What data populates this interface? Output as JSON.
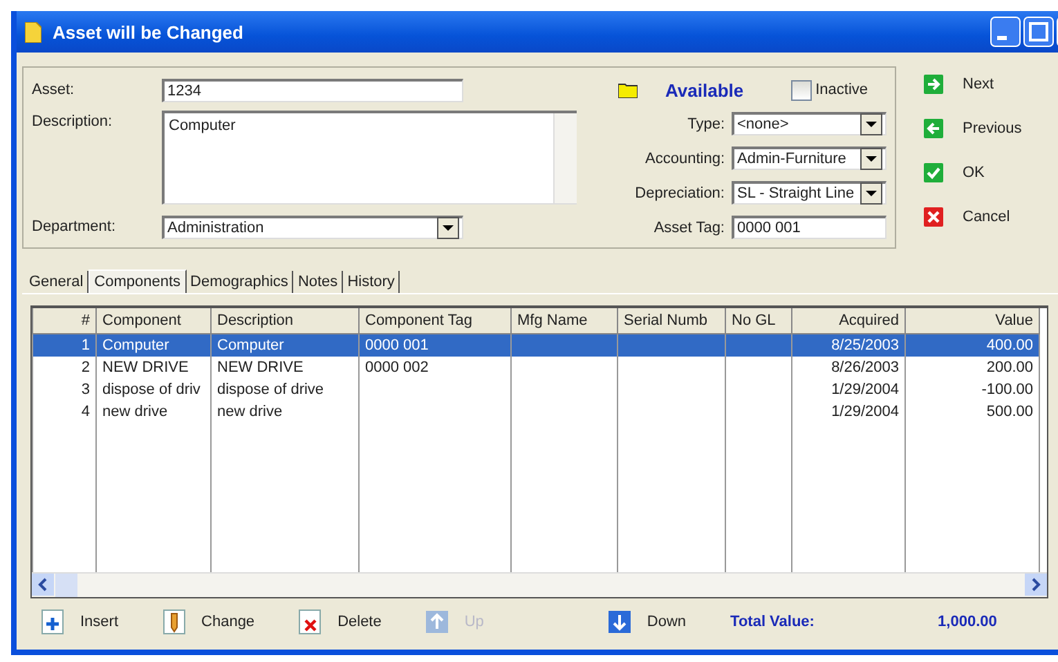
{
  "window": {
    "title": "Asset will be Changed"
  },
  "form": {
    "asset": {
      "label": "Asset:",
      "value": "1234"
    },
    "description": {
      "label": "Description:",
      "value": "Computer"
    },
    "department": {
      "label": "Department:",
      "value": "Administration"
    },
    "status": "Available",
    "inactive": {
      "label": "Inactive",
      "checked": false
    },
    "selects": [
      {
        "label": "Type:",
        "value": "<none>",
        "kind": "select"
      },
      {
        "label": "Accounting:",
        "value": "Admin-Furniture",
        "kind": "select"
      },
      {
        "label": "Depreciation:",
        "value": "SL - Straight Line",
        "kind": "select"
      },
      {
        "label": "Asset Tag:",
        "value": "0000 001",
        "kind": "text"
      }
    ]
  },
  "actions": [
    {
      "label": "Next",
      "kind": "next"
    },
    {
      "label": "Previous",
      "kind": "previous"
    },
    {
      "label": "OK",
      "kind": "ok"
    },
    {
      "label": "Cancel",
      "kind": "cancel"
    }
  ],
  "tabs": [
    {
      "label": "General",
      "selected": false
    },
    {
      "label": "Components",
      "selected": true
    },
    {
      "label": "Demographics",
      "selected": false
    },
    {
      "label": "Notes",
      "selected": false
    },
    {
      "label": "History",
      "selected": false
    }
  ],
  "table": {
    "columns": [
      "#",
      "Component",
      "Description",
      "Component Tag",
      "Mfg Name",
      "Serial Numb",
      "No GL",
      "Acquired",
      "Value"
    ],
    "rows": [
      {
        "selected": true,
        "cells": [
          "1",
          "Computer",
          "Computer",
          "0000 001",
          "",
          "",
          "",
          "8/25/2003",
          "400.00"
        ]
      },
      {
        "selected": false,
        "cells": [
          "2",
          "NEW DRIVE",
          "NEW DRIVE",
          "0000 002",
          "",
          "",
          "",
          "8/26/2003",
          "200.00"
        ]
      },
      {
        "selected": false,
        "cells": [
          "3",
          "dispose of driv",
          "dispose of drive",
          "",
          "",
          "",
          "",
          "1/29/2004",
          "-100.00"
        ]
      },
      {
        "selected": false,
        "cells": [
          "4",
          "new drive",
          "new drive",
          "",
          "",
          "",
          "",
          "1/29/2004",
          "500.00"
        ]
      }
    ]
  },
  "toolbar": [
    {
      "label": "Insert",
      "kind": "insert",
      "disabled": false
    },
    {
      "label": "Change",
      "kind": "change",
      "disabled": false
    },
    {
      "label": "Delete",
      "kind": "delete",
      "disabled": false
    },
    {
      "label": "Up",
      "kind": "up",
      "disabled": true
    },
    {
      "label": "Down",
      "kind": "down",
      "disabled": false
    }
  ],
  "total": {
    "label": "Total Value:",
    "value": "1,000.00"
  }
}
